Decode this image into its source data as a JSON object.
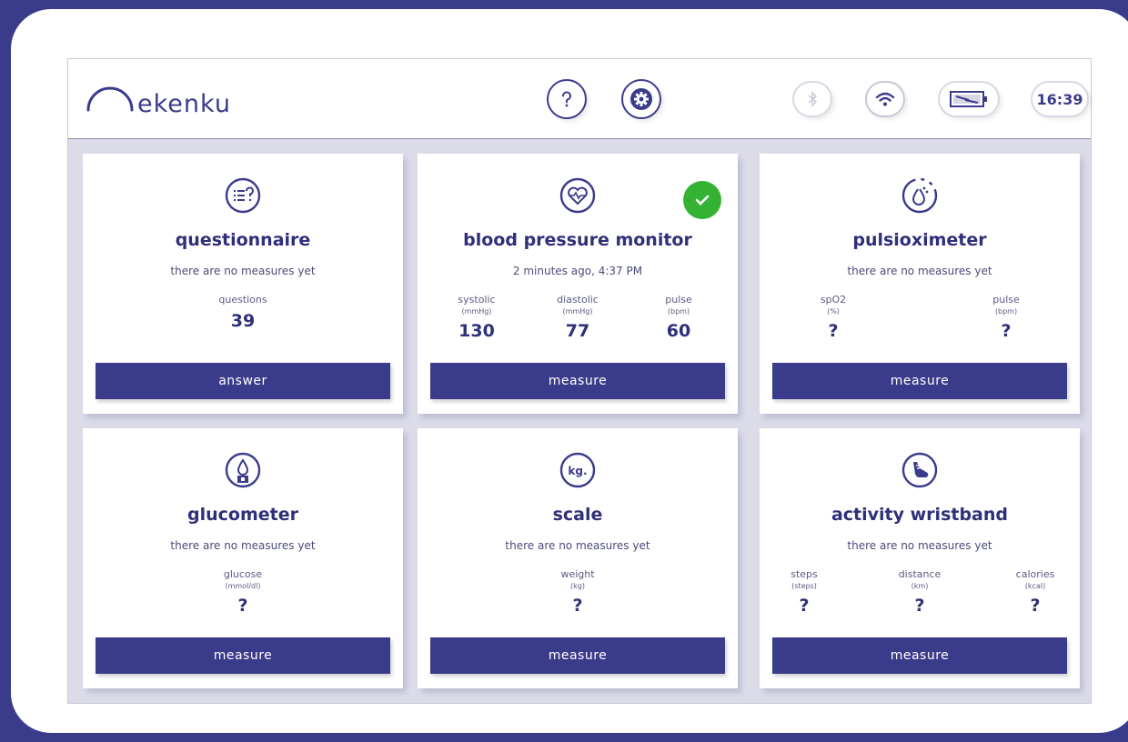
{
  "app": {
    "logo_text": "ekenku",
    "time": "16:39"
  },
  "icons": {
    "help": "help-icon",
    "settings": "gear-icon",
    "bluetooth": "bluetooth-icon",
    "wifi": "wifi-icon",
    "battery": "battery-charging-icon"
  },
  "colors": {
    "primary": "#3b3b8c",
    "success": "#34b234",
    "background": "#dcdce9"
  },
  "cards": [
    {
      "id": "questionnaire",
      "icon": "questionnaire-icon",
      "title": "questionnaire",
      "subtitle": "there are no measures yet",
      "metrics": [
        {
          "label": "questions",
          "unit": "",
          "value": "39"
        }
      ],
      "button": "answer",
      "done": false
    },
    {
      "id": "blood-pressure",
      "icon": "heart-pressure-icon",
      "title": "blood pressure monitor",
      "subtitle": "2 minutes ago, 4:37 PM",
      "metrics": [
        {
          "label": "systolic",
          "unit": "(mmHg)",
          "value": "130"
        },
        {
          "label": "diastolic",
          "unit": "(mmHg)",
          "value": "77"
        },
        {
          "label": "pulse",
          "unit": "(bpm)",
          "value": "60"
        }
      ],
      "button": "measure",
      "done": true
    },
    {
      "id": "pulsioximeter",
      "icon": "pulse-drop-icon",
      "title": "pulsioximeter",
      "subtitle": "there are no measures yet",
      "metrics": [
        {
          "label": "spO2",
          "unit": "(%)",
          "value": "?"
        },
        {
          "label": "pulse",
          "unit": "(bpm)",
          "value": "?"
        }
      ],
      "button": "measure",
      "done": false
    },
    {
      "id": "glucometer",
      "icon": "glucose-drop-icon",
      "title": "glucometer",
      "subtitle": "there are no measures yet",
      "metrics": [
        {
          "label": "glucose",
          "unit": "(mmol/dl)",
          "value": "?"
        }
      ],
      "button": "measure",
      "done": false
    },
    {
      "id": "scale",
      "icon": "scale-kg-icon",
      "icon_text": "kg.",
      "title": "scale",
      "subtitle": "there are no measures yet",
      "metrics": [
        {
          "label": "weight",
          "unit": "(kg)",
          "value": "?"
        }
      ],
      "button": "measure",
      "done": false
    },
    {
      "id": "wristband",
      "icon": "shoe-icon",
      "title": "activity wristband",
      "subtitle": "there are no measures yet",
      "metrics": [
        {
          "label": "steps",
          "unit": "(steps)",
          "value": "?"
        },
        {
          "label": "distance",
          "unit": "(km)",
          "value": "?"
        },
        {
          "label": "calories",
          "unit": "(kcal)",
          "value": "?"
        }
      ],
      "button": "measure",
      "done": false
    }
  ]
}
